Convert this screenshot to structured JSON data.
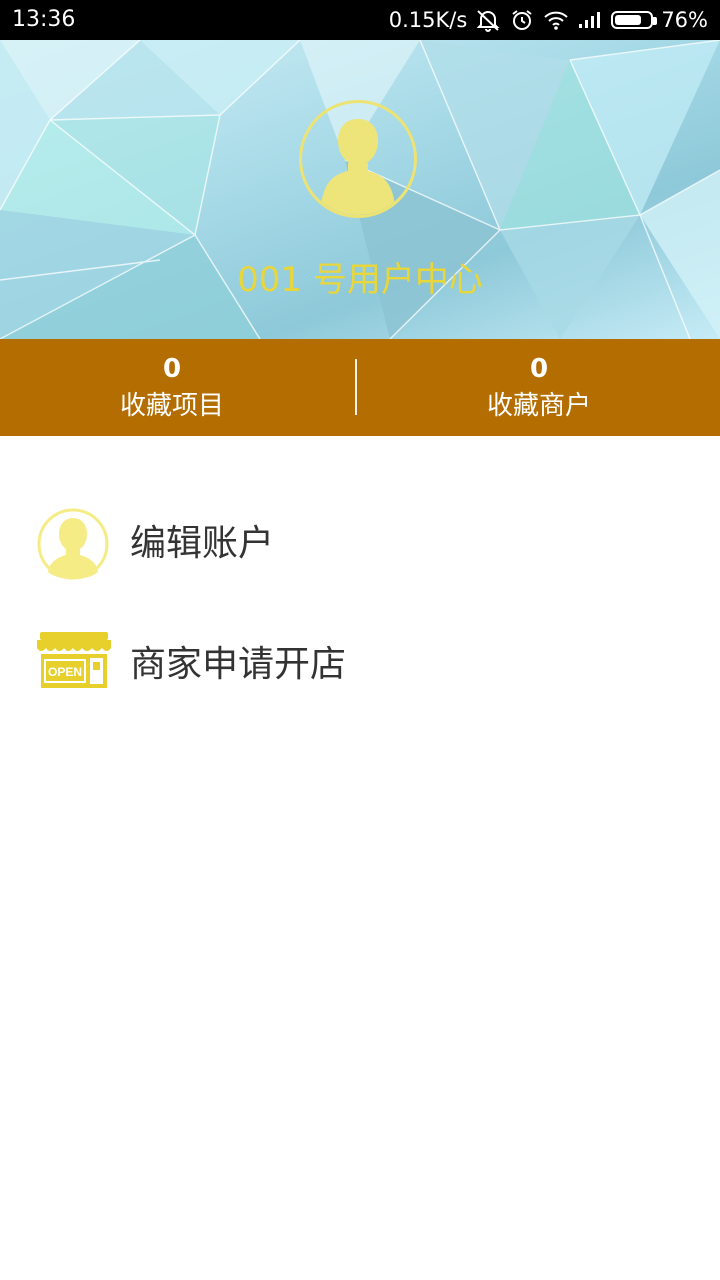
{
  "status_bar": {
    "time": "13:36",
    "network_speed": "0.15K/s",
    "battery_percent": "76%",
    "battery_level": 0.76,
    "icons": [
      "mute-icon",
      "alarm-icon",
      "wifi-icon",
      "signal-icon",
      "battery-icon"
    ]
  },
  "header": {
    "title": "001 号用户中心",
    "title_color": "#e8d63a",
    "avatar_icon": "user-avatar-icon"
  },
  "stats": {
    "background": "#b36d00",
    "favorite_projects": {
      "count": "0",
      "label": "收藏项目"
    },
    "favorite_merchants": {
      "count": "0",
      "label": "收藏商户"
    }
  },
  "menu": {
    "items": [
      {
        "label": "编辑账户",
        "icon": "user-icon"
      },
      {
        "label": "商家申请开店",
        "icon": "open-store-icon"
      }
    ]
  },
  "colors": {
    "accent_yellow": "#e8d63a",
    "text": "#333333"
  }
}
